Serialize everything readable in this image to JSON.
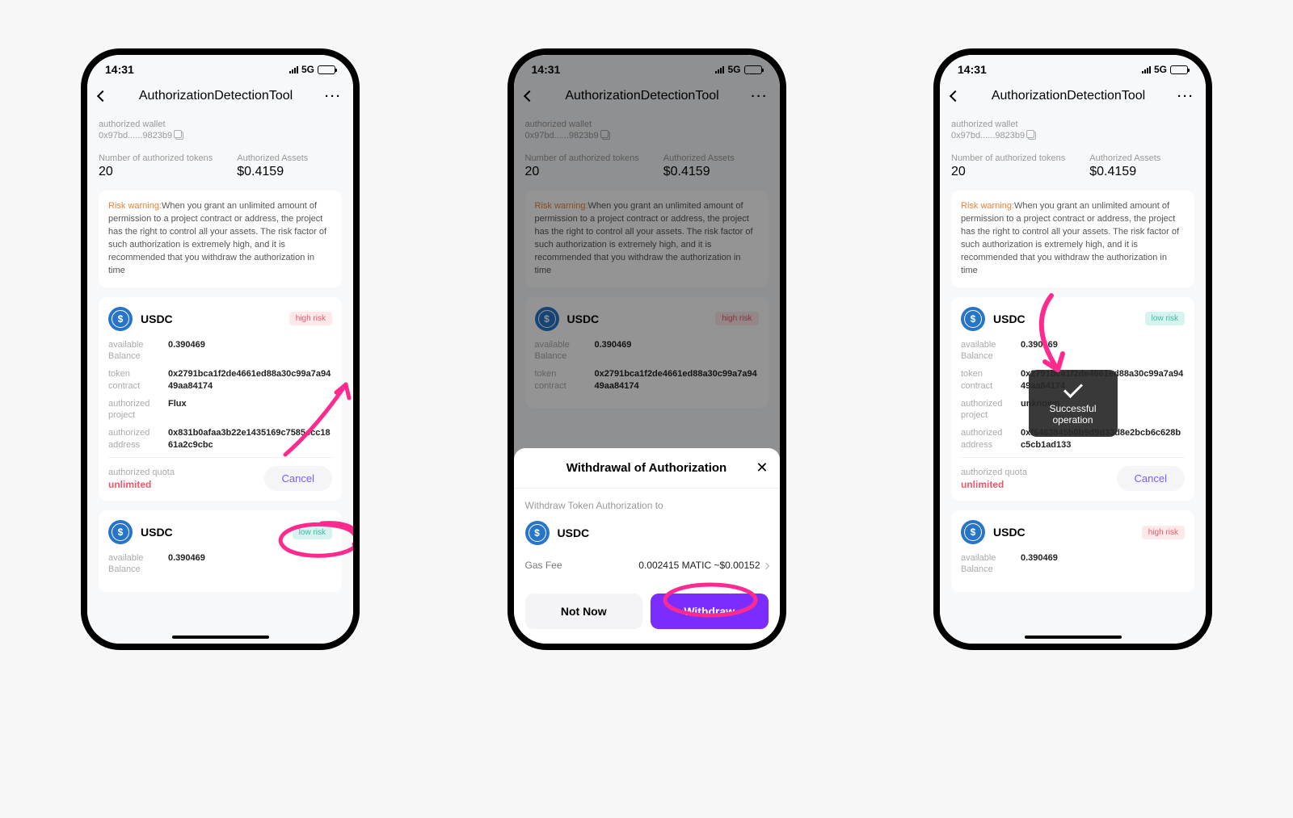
{
  "status": {
    "time": "14:31",
    "network": "5G"
  },
  "nav": {
    "title": "AuthorizationDetectionTool"
  },
  "wallet": {
    "label": "authorized wallet",
    "address": "0x97bd......9823b9"
  },
  "stats": {
    "token_count_label": "Number of authorized tokens",
    "token_count": "20",
    "assets_label": "Authorized Assets",
    "assets_value": "$0.4159"
  },
  "warning": {
    "label": "Risk warning:",
    "text": "When you grant an unlimited amount of permission to a project contract or address, the project has the right to control all your assets. The risk factor of such authorization is extremely high, and it is recommended that you withdraw the authorization in time"
  },
  "labels": {
    "available_balance": "available Balance",
    "token_contract": "token contract",
    "authorized_project": "authorized project",
    "authorized_address": "authorized address",
    "authorized_quota": "authorized quota",
    "cancel": "Cancel",
    "high_risk": "high risk",
    "low_risk": "low risk",
    "unlimited": "unlimited"
  },
  "token1": {
    "symbol": "USDC",
    "balance": "0.390469",
    "contract": "0x2791bca1f2de4661ed88a30c99a7a9449aa84174",
    "project": "Flux",
    "address": "0x831b0afaa3b22e1435169c7585ccc1861a2c9cbc"
  },
  "token2": {
    "symbol": "USDC",
    "balance": "0.390469"
  },
  "token3": {
    "symbol": "USDC",
    "balance": "0.390469",
    "contract": "0x2791bca1f2de4661ed88a30c99a7a9449aa84174",
    "project": "unknown",
    "address": "0xf6463845b0b9d9d33d8e2bcb6c628bc5cb1ad133"
  },
  "sheet": {
    "title": "Withdrawal of Authorization",
    "subtitle": "Withdraw Token Authorization to",
    "token": "USDC",
    "gas_label": "Gas Fee",
    "gas_value": "0.002415 MATIC ~$0.00152",
    "not_now": "Not Now",
    "withdraw": "Withdraw"
  },
  "toast": {
    "text": "Successful operation"
  }
}
